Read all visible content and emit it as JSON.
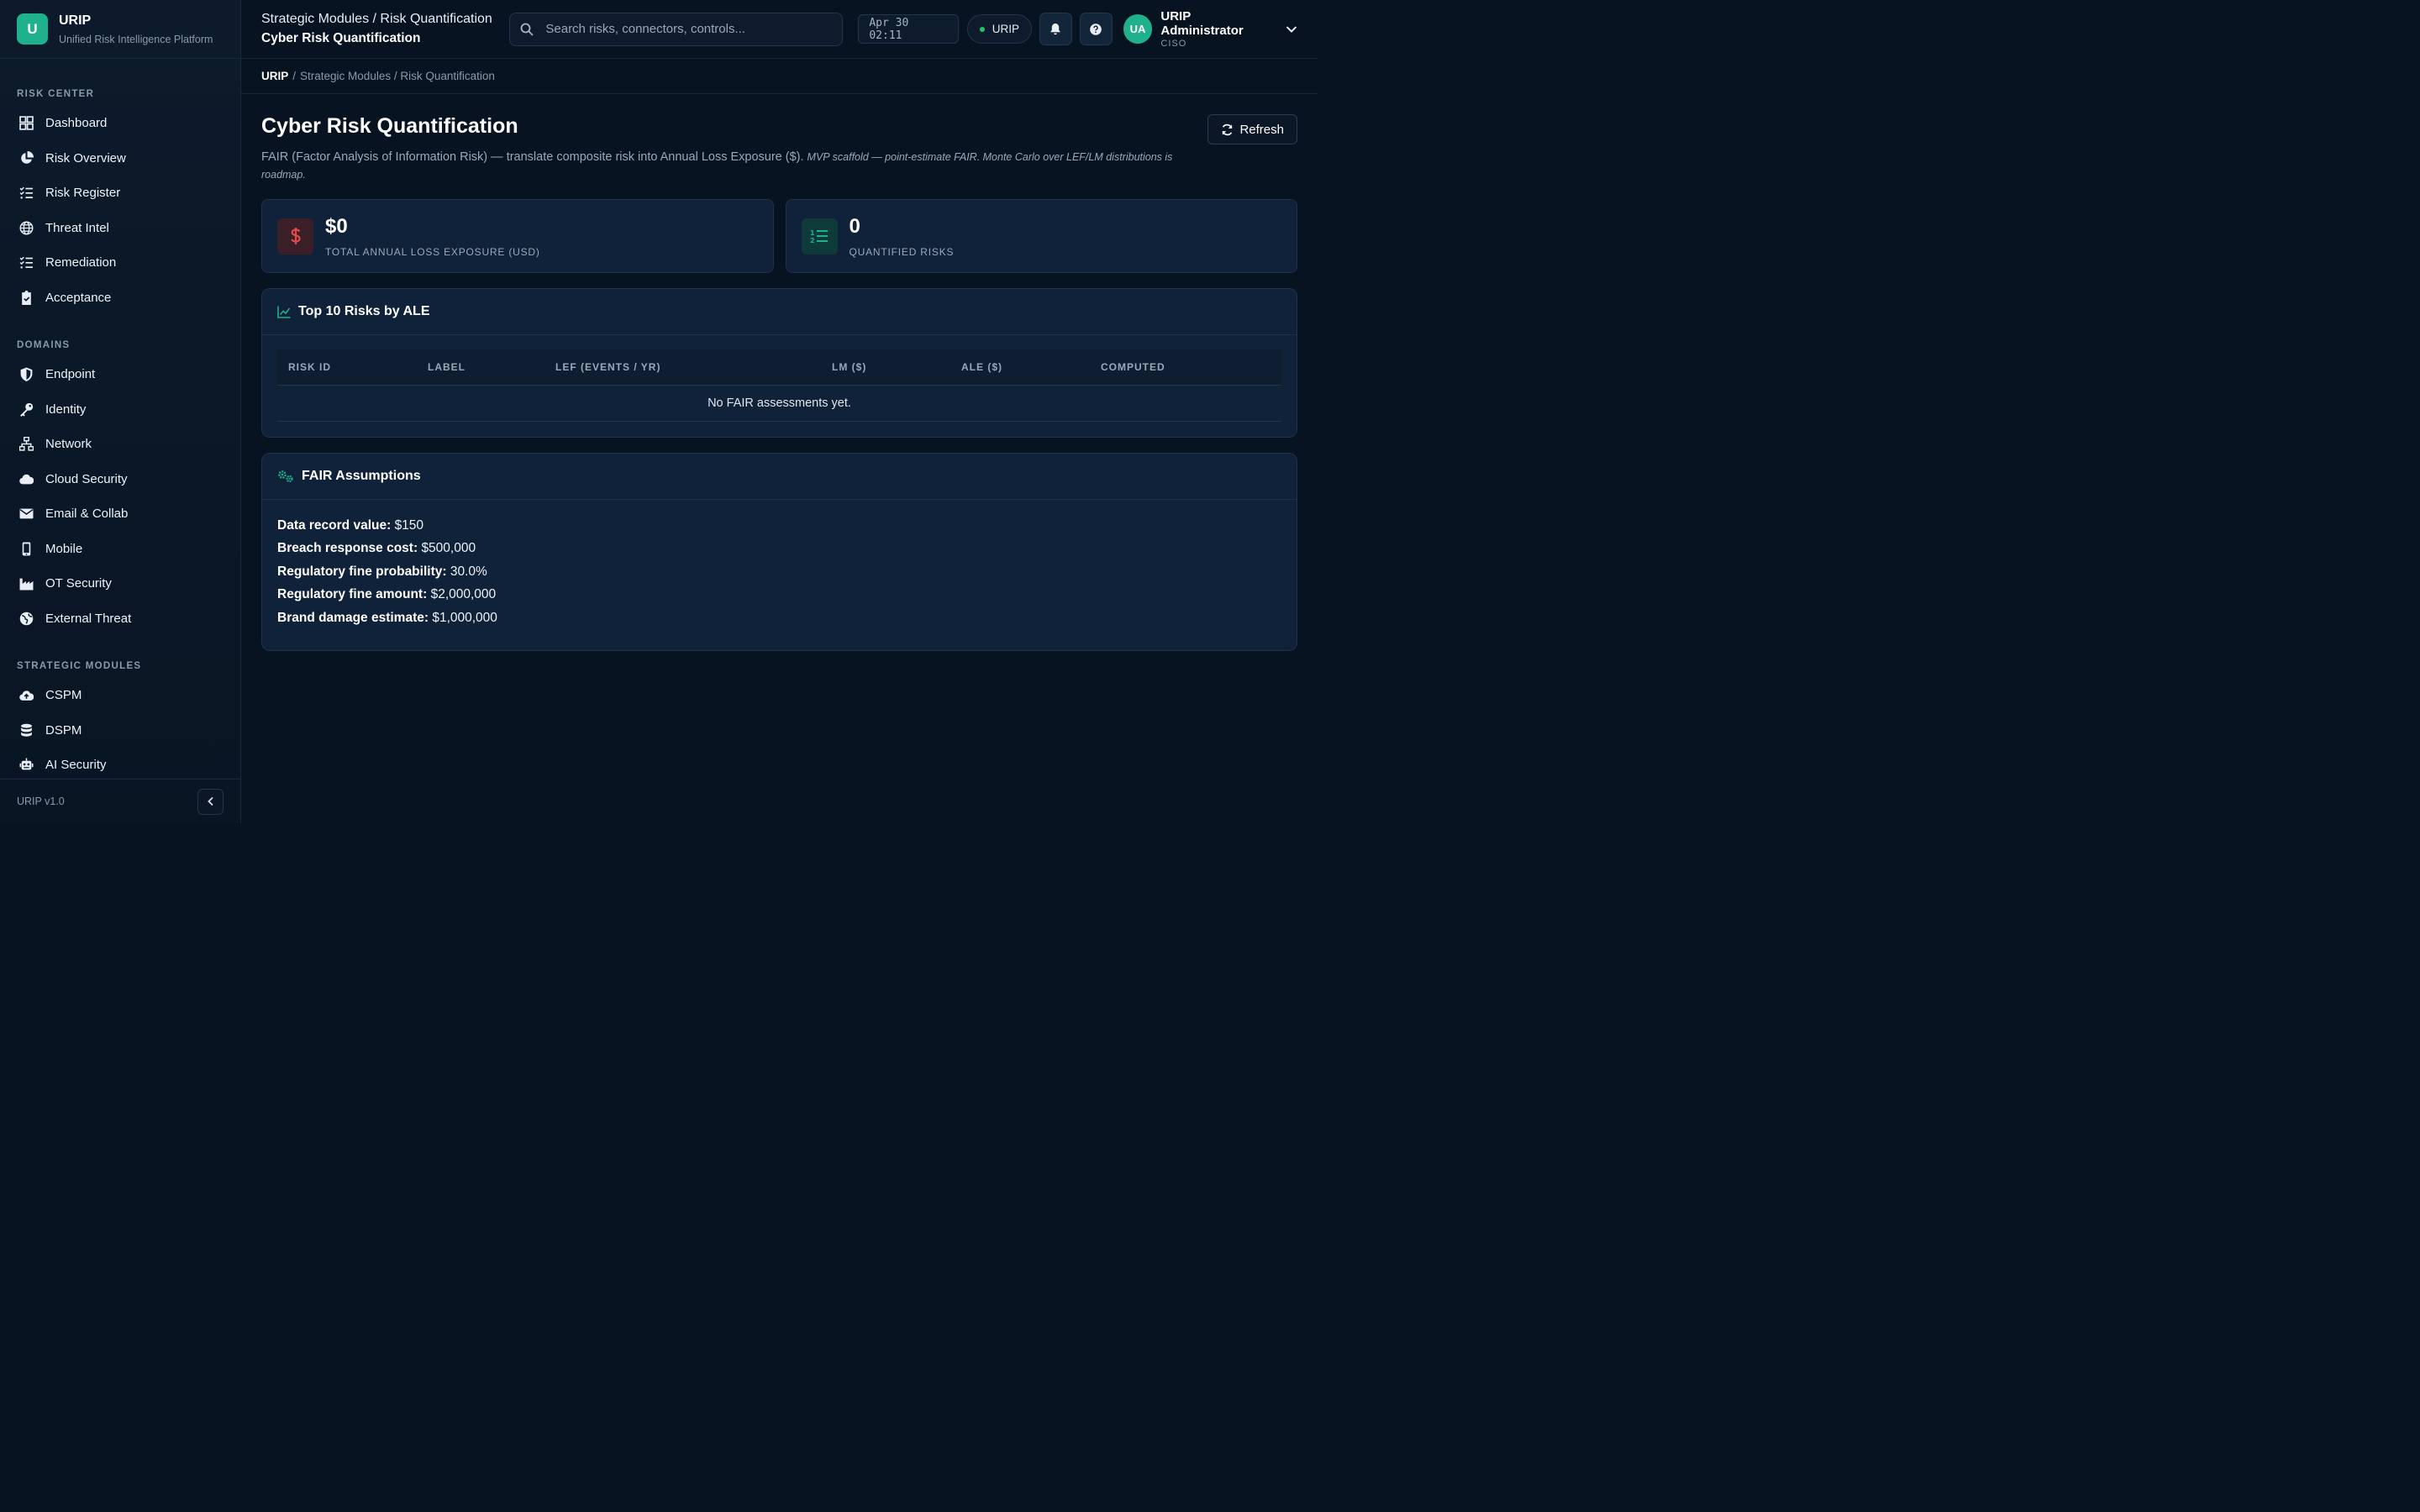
{
  "brand": {
    "logo_letter": "U",
    "name": "URIP",
    "tagline": "Unified Risk Intelligence Platform"
  },
  "sidebar": {
    "sections": [
      {
        "title": "RISK CENTER",
        "items": [
          {
            "label": "Dashboard",
            "icon": "dashboard-icon"
          },
          {
            "label": "Risk Overview",
            "icon": "pie-chart-icon"
          },
          {
            "label": "Risk Register",
            "icon": "list-check-icon"
          },
          {
            "label": "Threat Intel",
            "icon": "globe-icon"
          },
          {
            "label": "Remediation",
            "icon": "list-check-icon"
          },
          {
            "label": "Acceptance",
            "icon": "clipboard-check-icon"
          }
        ]
      },
      {
        "title": "DOMAINS",
        "items": [
          {
            "label": "Endpoint",
            "icon": "shield-icon"
          },
          {
            "label": "Identity",
            "icon": "key-icon"
          },
          {
            "label": "Network",
            "icon": "network-icon"
          },
          {
            "label": "Cloud Security",
            "icon": "cloud-icon"
          },
          {
            "label": "Email & Collab",
            "icon": "envelope-icon"
          },
          {
            "label": "Mobile",
            "icon": "mobile-icon"
          },
          {
            "label": "OT Security",
            "icon": "industry-icon"
          },
          {
            "label": "External Threat",
            "icon": "earth-icon"
          }
        ]
      },
      {
        "title": "STRATEGIC MODULES",
        "items": [
          {
            "label": "CSPM",
            "icon": "cloud-upload-icon"
          },
          {
            "label": "DSPM",
            "icon": "database-icon"
          },
          {
            "label": "AI Security",
            "icon": "robot-icon"
          }
        ]
      }
    ],
    "version": "URIP v1.0"
  },
  "topbar": {
    "crumb": "Strategic Modules / Risk Quantification",
    "page": "Cyber Risk Quantification",
    "search_placeholder": "Search risks, connectors, controls...",
    "clock": "Apr 30 02:11",
    "tenant": "URIP",
    "user_initials": "UA",
    "user_name": "URIP Administrator",
    "user_role": "CISO"
  },
  "breadcrumb": {
    "root": "URIP",
    "rest": "Strategic Modules / Risk Quantification"
  },
  "page": {
    "title": "Cyber Risk Quantification",
    "description": "FAIR (Factor Analysis of Information Risk) — translate composite risk into Annual Loss Exposure ($).",
    "note": "MVP scaffold — point-estimate FAIR. Monte Carlo over LEF/LM distributions is roadmap.",
    "refresh_label": "Refresh"
  },
  "stats": [
    {
      "value": "$0",
      "label": "TOTAL ANNUAL LOSS EXPOSURE (USD)",
      "icon": "dollar-icon",
      "accent": "#e5484d"
    },
    {
      "value": "0",
      "label": "QUANTIFIED RISKS",
      "icon": "ordered-list-icon",
      "accent": "#1fb08c"
    }
  ],
  "top_risks": {
    "title": "Top 10 Risks by ALE",
    "columns": [
      "RISK ID",
      "LABEL",
      "LEF (EVENTS / YR)",
      "LM ($)",
      "ALE ($)",
      "COMPUTED"
    ],
    "empty_text": "No FAIR assessments yet."
  },
  "assumptions": {
    "title": "FAIR Assumptions",
    "items": [
      {
        "label": "Data record value:",
        "value": "$150"
      },
      {
        "label": "Breach response cost:",
        "value": "$500,000"
      },
      {
        "label": "Regulatory fine probability:",
        "value": "30.0%"
      },
      {
        "label": "Regulatory fine amount:",
        "value": "$2,000,000"
      },
      {
        "label": "Brand damage estimate:",
        "value": "$1,000,000"
      }
    ]
  },
  "colors": {
    "accent": "#1fb08c",
    "background": "#071320",
    "card": "#102239",
    "danger": "#e5484d"
  }
}
